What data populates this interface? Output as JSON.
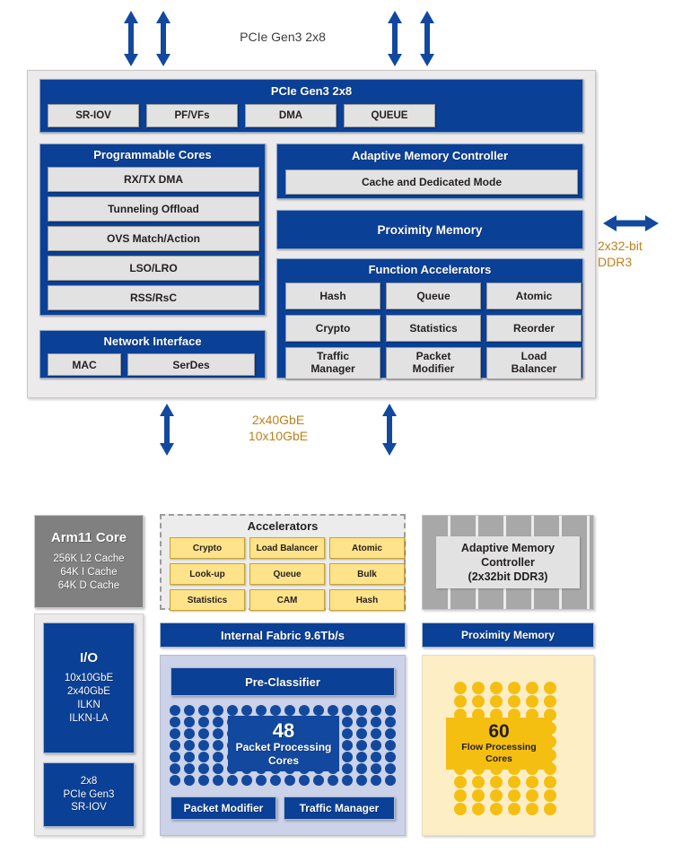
{
  "top_diagram": {
    "external_labels": {
      "pcie_top": "PCIe Gen3 2x8",
      "ddr3_right": "2x32-bit\nDDR3",
      "ethernet_bottom": "2x40GbE\n10x10GbE"
    },
    "pcie_block": {
      "title": "PCIe Gen3 2x8",
      "chips": [
        "SR-IOV",
        "PF/VFs",
        "DMA",
        "QUEUE"
      ]
    },
    "programmable_cores": {
      "title": "Programmable Cores",
      "chips": [
        "RX/TX DMA",
        "Tunneling Offload",
        "OVS Match/Action",
        "LSO/LRO",
        "RSS/RsC"
      ]
    },
    "network_interface": {
      "title": "Network Interface",
      "chips": [
        "MAC",
        "SerDes"
      ]
    },
    "adaptive_memory_controller": {
      "title": "Adaptive Memory Controller",
      "chips": [
        "Cache and Dedicated Mode"
      ]
    },
    "proximity_memory": {
      "title": "Proximity Memory"
    },
    "function_accelerators": {
      "title": "Function Accelerators",
      "chips": [
        "Hash",
        "Queue",
        "Atomic",
        "Crypto",
        "Statistics",
        "Reorder",
        "Traffic\nManager",
        "Packet\nModifier",
        "Load\nBalancer"
      ]
    }
  },
  "bottom_diagram": {
    "arm_core": {
      "title": "Arm11 Core",
      "details": "256K L2 Cache\n64K I Cache\n64K D Cache"
    },
    "io_block": {
      "title": "I/O",
      "details": "10x10GbE\n2x40GbE\nILKN\nILKN-LA"
    },
    "pcie_block": {
      "details": "2x8\nPCIe Gen3\nSR-IOV"
    },
    "accelerators": {
      "title": "Accelerators",
      "chips": [
        "Crypto",
        "Load Balancer",
        "Atomic",
        "Look-up",
        "Queue",
        "Bulk",
        "Statistics",
        "CAM",
        "Hash"
      ]
    },
    "internal_fabric": {
      "label": "Internal Fabric 9.6Tb/s"
    },
    "packet_processing": {
      "pre_classifier": "Pre-Classifier",
      "core_count": "48",
      "core_caption": "Packet Processing\nCores",
      "bottom_chips": [
        "Packet Modifier",
        "Traffic Manager"
      ],
      "dot_columns": 16,
      "dot_rows": 7
    },
    "adaptive_memory_controller": {
      "label": "Adaptive Memory\nController\n(2x32bit DDR3)"
    },
    "proximity_memory": {
      "label": "Proximity Memory"
    },
    "flow_processing": {
      "core_count": "60",
      "core_caption": "Flow Processing\nCores",
      "dot_columns": 6,
      "dot_rows": 10
    }
  },
  "colors": {
    "blue": "#0B4097",
    "dot_blue": "#12499F",
    "yellow": "#F5BF12",
    "chip_yellow": "#FFE38A",
    "grey": "#808080",
    "label_orange": "#C07F18"
  }
}
